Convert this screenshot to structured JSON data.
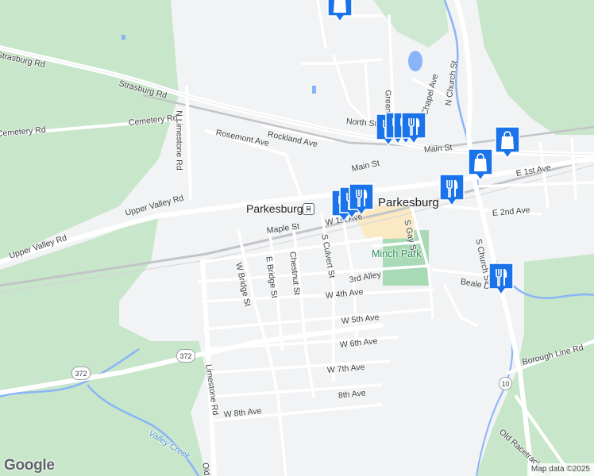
{
  "map": {
    "town_label": "Parkesburg",
    "park_label": "Minch Park",
    "water_label": "Valley Creek",
    "streets": [
      {
        "id": "strasburg-rd-1",
        "text": "Strasburg Rd"
      },
      {
        "id": "strasburg-rd-2",
        "text": "Strasburg Rd"
      },
      {
        "id": "cemetery-rd-1",
        "text": "Cemetery Rd"
      },
      {
        "id": "cemetery-rd-2",
        "text": "Cemetery Rd"
      },
      {
        "id": "n-limestone-rd",
        "text": "N Limestone Rd"
      },
      {
        "id": "rosemont-ave",
        "text": "Rosemont Ave"
      },
      {
        "id": "rockland-ave",
        "text": "Rockland Ave"
      },
      {
        "id": "north-st",
        "text": "North St"
      },
      {
        "id": "green-st",
        "text": "Green St"
      },
      {
        "id": "chapel-ave",
        "text": "Chapel Ave"
      },
      {
        "id": "n-church-st",
        "text": "N Church St"
      },
      {
        "id": "main-st-1",
        "text": "Main St"
      },
      {
        "id": "main-st-2",
        "text": "Main St"
      },
      {
        "id": "e-1st-ave",
        "text": "E 1st Ave"
      },
      {
        "id": "e-2nd-ave",
        "text": "E 2nd Ave"
      },
      {
        "id": "upper-valley-rd-1",
        "text": "Upper Valley Rd"
      },
      {
        "id": "upper-valley-rd-2",
        "text": "Upper Valley Rd"
      },
      {
        "id": "maple-st",
        "text": "Maple St"
      },
      {
        "id": "w-1st-ave",
        "text": "W 1st Ave"
      },
      {
        "id": "w-bridge-st",
        "text": "W Bridge St"
      },
      {
        "id": "e-bridge-st",
        "text": "E Bridge St"
      },
      {
        "id": "chestnut-st",
        "text": "Chestnut St"
      },
      {
        "id": "s-culvert-st",
        "text": "S Culvert St"
      },
      {
        "id": "s-gay-st",
        "text": "S Gay St"
      },
      {
        "id": "s-church-st",
        "text": "S Church St"
      },
      {
        "id": "beale-dr",
        "text": "Beale Dr"
      },
      {
        "id": "3rd-alley",
        "text": "3rd Alley"
      },
      {
        "id": "w-4th-ave",
        "text": "W 4th Ave"
      },
      {
        "id": "w-5th-ave",
        "text": "W 5th Ave"
      },
      {
        "id": "w-6th-ave",
        "text": "W 6th Ave"
      },
      {
        "id": "w-7th-ave",
        "text": "W 7th Ave"
      },
      {
        "id": "8th-ave",
        "text": "8th Ave"
      },
      {
        "id": "w-8th-ave",
        "text": "W 8th Ave"
      },
      {
        "id": "borough-line-rd",
        "text": "Borough Line Rd"
      },
      {
        "id": "limestone-rd",
        "text": "Limestone Rd"
      },
      {
        "id": "old-racetrack-rd",
        "text": "Old Racetrack Rd"
      },
      {
        "id": "old-limestone",
        "text": "Old"
      }
    ],
    "route_shields": [
      {
        "id": "route-372-a",
        "text": "372"
      },
      {
        "id": "route-372-b",
        "text": "372"
      },
      {
        "id": "route-10",
        "text": "10"
      }
    ],
    "markers": [
      {
        "id": "shopping-bag-marker-top",
        "icon": "shopping-bag-icon"
      },
      {
        "id": "restaurant-marker-north-1",
        "icon": "fork-knife-icon"
      },
      {
        "id": "restaurant-marker-north-2",
        "icon": "fork-knife-icon"
      },
      {
        "id": "restaurant-marker-north-3",
        "icon": "fork-knife-icon"
      },
      {
        "id": "restaurant-marker-north-4",
        "icon": "fork-knife-icon"
      },
      {
        "id": "shopping-bag-marker-east",
        "icon": "shopping-bag-icon"
      },
      {
        "id": "shopping-bag-marker-main",
        "icon": "shopping-bag-icon"
      },
      {
        "id": "restaurant-marker-east",
        "icon": "fork-knife-icon"
      },
      {
        "id": "restaurant-marker-center-1",
        "icon": "fork-knife-icon"
      },
      {
        "id": "restaurant-marker-center-2",
        "icon": "fork-knife-icon"
      },
      {
        "id": "restaurant-marker-center-3",
        "icon": "fork-knife-icon"
      },
      {
        "id": "restaurant-marker-church",
        "icon": "fork-knife-icon"
      }
    ],
    "colors": {
      "marker": "#1a73e8",
      "park": "#a8dab5",
      "forest": "#c8e6c9",
      "water": "#8ab4f8",
      "commercial": "#fbe9c4"
    }
  },
  "footer": {
    "logo": "Google",
    "attribution": "Map data ©2025"
  }
}
